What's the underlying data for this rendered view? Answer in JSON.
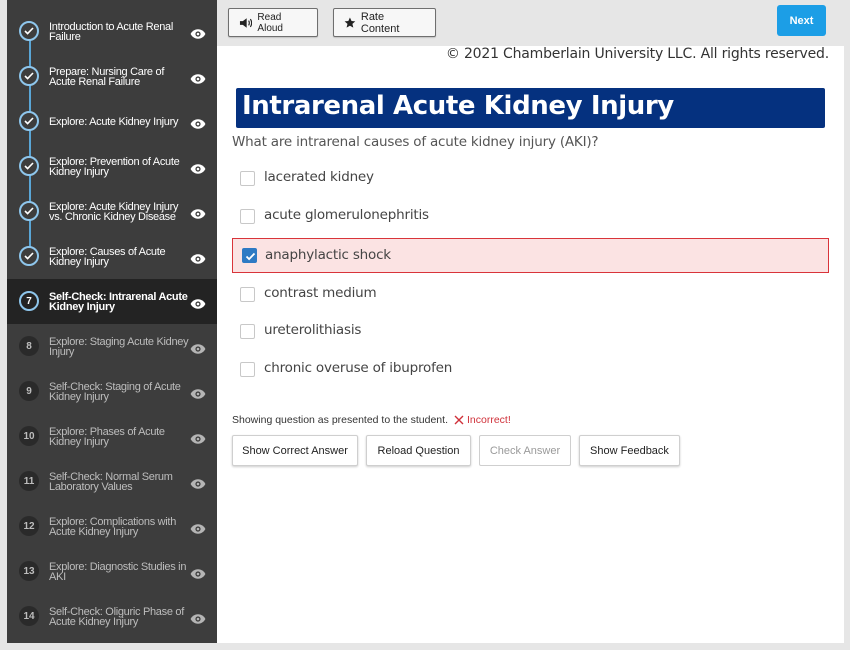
{
  "sidebar": {
    "items": [
      {
        "number": "",
        "label": "Introduction to Acute Renal Failure",
        "state": "done"
      },
      {
        "number": "",
        "label": "Prepare: Nursing Care of Acute Renal Failure",
        "state": "done"
      },
      {
        "number": "",
        "label": "Explore: Acute Kidney Injury",
        "state": "done"
      },
      {
        "number": "",
        "label": "Explore: Prevention of Acute Kidney Injury",
        "state": "done"
      },
      {
        "number": "",
        "label": "Explore: Acute Kidney Injury vs. Chronic Kidney Disease",
        "state": "done"
      },
      {
        "number": "",
        "label": "Explore: Causes of Acute Kidney Injury",
        "state": "done"
      },
      {
        "number": "7",
        "label": "Self-Check: Intrarenal Acute Kidney Injury",
        "state": "current"
      },
      {
        "number": "8",
        "label": "Explore: Staging Acute Kidney Injury",
        "state": "todo"
      },
      {
        "number": "9",
        "label": "Self-Check: Staging of Acute Kidney Injury",
        "state": "todo"
      },
      {
        "number": "10",
        "label": "Explore: Phases of Acute Kidney Injury",
        "state": "todo"
      },
      {
        "number": "11",
        "label": "Self-Check: Normal Serum Laboratory Values",
        "state": "todo"
      },
      {
        "number": "12",
        "label": "Explore: Complications with Acute Kidney Injury",
        "state": "todo"
      },
      {
        "number": "13",
        "label": "Explore: Diagnostic Studies in AKI",
        "state": "todo"
      },
      {
        "number": "14",
        "label": "Self-Check: Oliguric Phase of Acute Kidney Injury",
        "state": "todo"
      }
    ],
    "eye_icon": "eye-icon",
    "check_icon": "check-icon"
  },
  "toolbar": {
    "read_aloud_label": "Read Aloud",
    "read_aloud_icon": "speaker-icon",
    "rate_label": "Rate Content",
    "rate_icon": "star-icon",
    "next_label": "Next"
  },
  "copyright": "© 2021 Chamberlain University LLC. All rights reserved.",
  "page_title": "Intrarenal Acute Kidney Injury",
  "question": "What are intrarenal causes of acute kidney injury (AKI)?",
  "options": [
    {
      "label": "lacerated kidney",
      "checked": false
    },
    {
      "label": "acute glomerulonephritis",
      "checked": false
    },
    {
      "label": "anaphylactic shock",
      "checked": true
    },
    {
      "label": "contrast medium",
      "checked": false
    },
    {
      "label": "ureterolithiasis",
      "checked": false
    },
    {
      "label": "chronic overuse of ibuprofen",
      "checked": false
    }
  ],
  "status": {
    "text": "Showing question as presented to the student.",
    "result": "Incorrect!",
    "result_icon": "x-icon"
  },
  "actions": {
    "show_correct": "Show Correct Answer",
    "reload": "Reload Question",
    "check": "Check Answer",
    "feedback": "Show Feedback"
  },
  "colors": {
    "sidebar_bg": "#3d3d3d",
    "title_bg": "#05317f",
    "next_bg": "#1c9ee6",
    "incorrect": "#d0313a",
    "selected_bg": "#fbe3e3",
    "checkbox_checked": "#2e7ac4"
  }
}
